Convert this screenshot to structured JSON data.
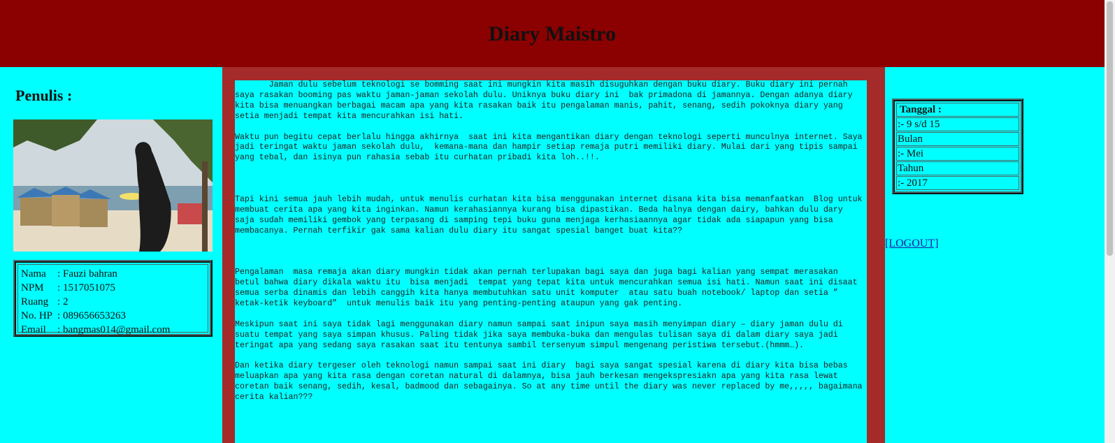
{
  "header": {
    "title": "Diary Maistro"
  },
  "left": {
    "heading": "Penulis :",
    "info": [
      {
        "key": "Nama",
        "value": "Fauzi bahran"
      },
      {
        "key": "NPM",
        "value": "1517051075"
      },
      {
        "key": "Ruang",
        "value": "2"
      },
      {
        "key": "No. HP",
        "value": "089656653263"
      },
      {
        "key": "Email",
        "value": "bangmas014@gmail.com"
      }
    ]
  },
  "content": {
    "paragraphs": [
      "       Jaman dulu sebelum teknologi se bomming saat ini mungkin kita masih disuguhkan dengan buku diary. Buku diary ini pernah saya rasakan booming pas waktu jaman-jaman sekolah dulu. Uniknya buku diary ini  bak primadona di jamannya. Dengan adanya diary kita bisa menuangkan berbagai macam apa yang kita rasakan baik itu pengalaman manis, pahit, senang, sedih pokoknya diary yang setia menjadi tempat kita mencurahkan isi hati.",
      "Waktu pun begitu cepat berlalu hingga akhirnya  saat ini kita mengantikan diary dengan teknologi seperti munculnya internet. Saya jadi teringat waktu jaman sekolah dulu,  kemana-mana dan hampir setiap remaja putri memiliki diary. Mulai dari yang tipis sampai yang tebal, dan isinya pun rahasia sebab itu curhatan pribadi kita loh..!!.",
      "Tapi kini semua jauh lebih mudah, untuk menulis curhatan kita bisa menggunakan internet disana kita bisa memanfaatkan  Blog untuk membuat cerita apa yang kita inginkan. Namun kerahasiannya kurang bisa dipastikan. Beda halnya dengan dairy, bahkan dulu dary saja sudah memiliki gembok yang terpasang di samping tepi buku guna menjaga kerhasiaannya agar tidak ada siapapun yang bisa membacanya. Pernah terfikir gak sama kalian dulu diary itu sangat spesial banget buat kita??",
      "Pengalaman  masa remaja akan diary mungkin tidak akan pernah terlupakan bagi saya dan juga bagi kalian yang sempat merasakan betul bahwa diary dikala waktu itu  bisa menjadi  tempat yang tepat kita untuk mencurahkan semua isi hati. Namun saat ini disaat semua serba dinamis dan lebih canggih kita hanya membutuhkan satu unit komputer  atau satu buah notebook/ laptop dan setia ” ketak-ketik keyboard”  untuk menulis baik itu yang penting-penting ataupun yang gak penting.",
      "Meskipun saat ini saya tidak lagi menggunakan diary namun sampai saat inipun saya masih menyimpan diary – diary jaman dulu di suatu tempat yang saya simpan khusus. Paling tidak jika saya membuka-buka dan mengulas tulisan saya di dalam diary saya jadi teringat apa yang sedang saya rasakan saat itu tentunya sambil tersenyum simpul mengenang peristiwa tersebut.(hmmm…).",
      "Dan ketika diary tergeser oleh teknologi namun sampai saat ini diary  bagi saya sangat spesial karena di diary kita bisa bebas meluapkan apa yang kita rasa dengan coretan natural di dalamnya, bisa jauh berkesan mengekspresiakn apa yang kita rasa lewat coretan baik senang, sedih, kesal, badmood dan sebagainya. So at any time until the diary was never replaced by me,,,,, bagaimana cerita kalian???"
    ]
  },
  "right": {
    "date": [
      "Tanggal :",
      ":- 9 s/d 15",
      "Bulan",
      ":- Mei",
      "Tahun",
      ":- 2017"
    ],
    "logout": " [LOGOUT]"
  },
  "colors": {
    "header_bg": "#8b0000",
    "page_bg": "#00ffff",
    "middle_frame": "#a52a2a",
    "link": "#1a1aa6"
  }
}
